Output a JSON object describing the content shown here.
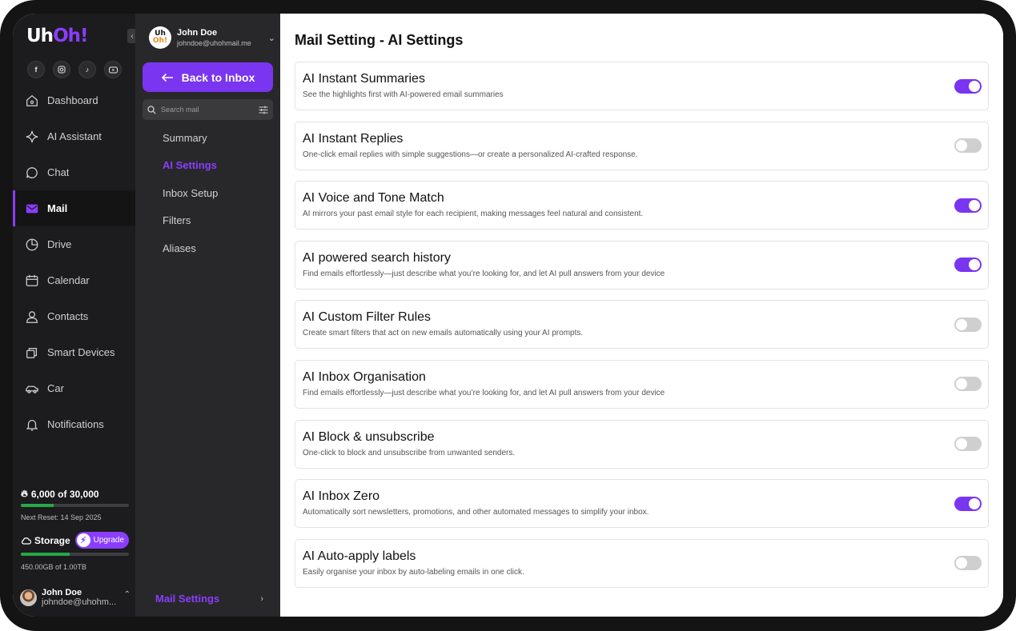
{
  "brand": {
    "logo_part1": "Uh",
    "logo_part2": "Oh!"
  },
  "socials": [
    "facebook-icon",
    "instagram-icon",
    "tiktok-icon",
    "youtube-icon"
  ],
  "nav": {
    "items": [
      {
        "label": "Dashboard",
        "icon": "home-icon"
      },
      {
        "label": "AI Assistant",
        "icon": "sparkle-icon"
      },
      {
        "label": "Chat",
        "icon": "chat-icon"
      },
      {
        "label": "Mail",
        "icon": "mail-icon",
        "active": true
      },
      {
        "label": "Drive",
        "icon": "pie-icon"
      },
      {
        "label": "Calendar",
        "icon": "calendar-icon"
      },
      {
        "label": "Contacts",
        "icon": "user-icon"
      },
      {
        "label": "Smart Devices",
        "icon": "devices-icon"
      },
      {
        "label": "Car",
        "icon": "car-icon"
      },
      {
        "label": "Notifications",
        "icon": "bell-icon"
      }
    ]
  },
  "credits": {
    "label": "6,000 of 30,000",
    "fraction": 0.3,
    "reset": "Next Reset: 14 Sep 2025"
  },
  "storage": {
    "label": "Storage",
    "upgrade": "Upgrade",
    "size": "450.00GB of 1.00TB",
    "fraction": 0.45
  },
  "nav_user": {
    "name": "John Doe",
    "email": "johndoe@uhohm..."
  },
  "account": {
    "avatar_top": "Uh",
    "avatar_bottom": "Oh!",
    "name": "John Doe",
    "email": "johndoe@uhohmail.me"
  },
  "mail_nav": {
    "back_label": "Back to Inbox",
    "search_placeholder": "Search mail",
    "items": [
      "Summary",
      "AI Settings",
      "Inbox Setup",
      "Filters",
      "Aliases"
    ],
    "active_index": 1,
    "footer_label": "Mail Settings"
  },
  "main": {
    "title": "Mail Setting - AI Settings",
    "settings": [
      {
        "title": "AI Instant Summaries",
        "desc": "See the highlights first with AI-powered email summaries",
        "on": true
      },
      {
        "title": "AI Instant Replies",
        "desc": "One-click email replies with simple suggestions—or create a personalized AI-crafted response.",
        "on": false
      },
      {
        "title": "AI Voice and Tone Match",
        "desc": "AI mirrors your past email style for each recipient, making messages feel natural and consistent.",
        "on": true
      },
      {
        "title": "AI powered search history",
        "desc": "Find emails effortlessly—just describe what you’re looking for, and let AI pull answers from your device",
        "on": true
      },
      {
        "title": "AI Custom Filter Rules",
        "desc": "Create smart filters that act on new emails automatically using your AI prompts.",
        "on": false
      },
      {
        "title": "AI Inbox Organisation",
        "desc": "Find emails effortlessly—just describe what you’re looking for, and let AI pull answers from your device",
        "on": false
      },
      {
        "title": "AI Block & unsubscribe",
        "desc": "One-click to block and unsubscribe from unwanted senders.",
        "on": false
      },
      {
        "title": "AI Inbox Zero",
        "desc": "Automatically sort newsletters, promotions, and other automated messages to simplify your inbox.",
        "on": true
      },
      {
        "title": "AI Auto-apply labels",
        "desc": "Easily organise your inbox by auto-labeling emails in one click.",
        "on": false
      }
    ]
  },
  "colors": {
    "accent": "#7a35f0",
    "brand_purple": "#8b3dff",
    "progress_green": "#26a848"
  }
}
